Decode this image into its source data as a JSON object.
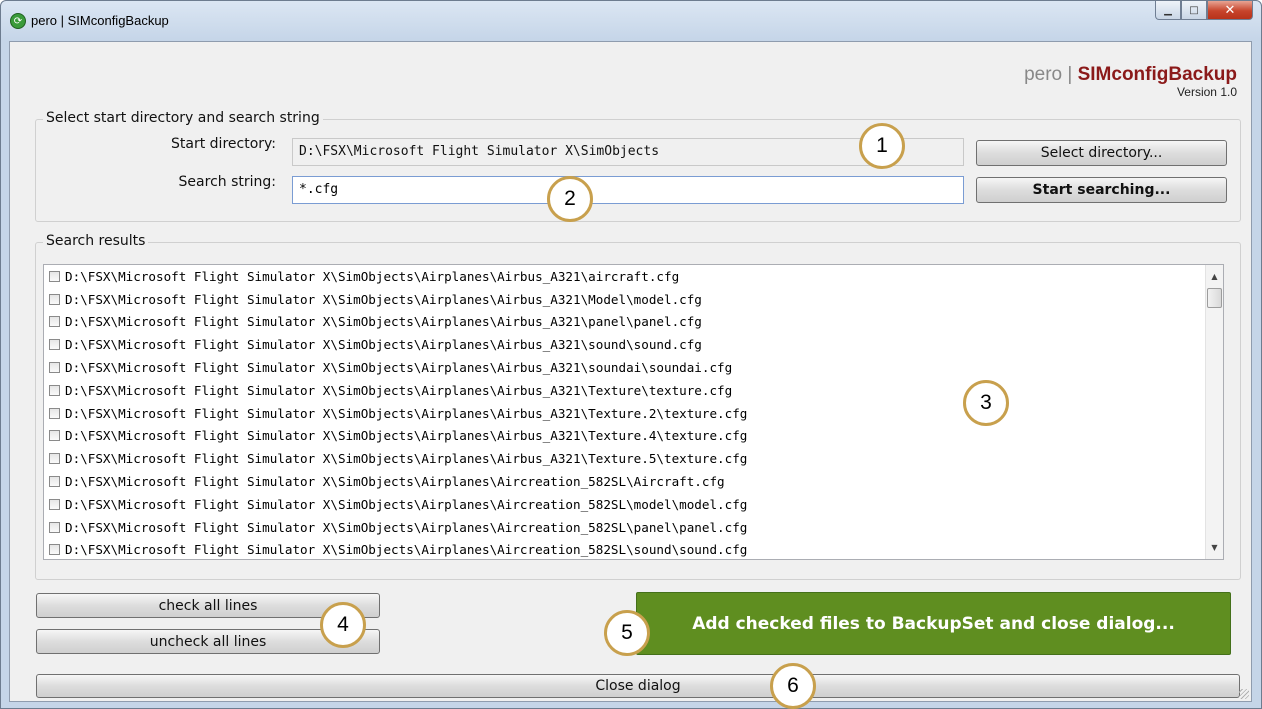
{
  "window": {
    "title": "pero | SIMconfigBackup",
    "icon": "app-logo-icon",
    "controls": {
      "minimize": "minimize-icon",
      "maximize": "maximize-icon",
      "close": "close-icon"
    }
  },
  "brand": {
    "prefix": "pero",
    "separator": "|",
    "name": "SIMconfigBackup",
    "version": "Version 1.0",
    "name_color": "#8b1a1a"
  },
  "search_group": {
    "legend": "Select start directory and search string",
    "start_dir_label": "Start directory:",
    "start_dir_value": "D:\\FSX\\Microsoft Flight Simulator X\\SimObjects",
    "search_label": "Search string:",
    "search_value": "*.cfg",
    "select_dir_button": "Select directory...",
    "start_search_button": "Start searching..."
  },
  "results_group": {
    "legend": "Search results",
    "items": [
      "D:\\FSX\\Microsoft Flight Simulator X\\SimObjects\\Airplanes\\Airbus_A321\\aircraft.cfg",
      "D:\\FSX\\Microsoft Flight Simulator X\\SimObjects\\Airplanes\\Airbus_A321\\Model\\model.cfg",
      "D:\\FSX\\Microsoft Flight Simulator X\\SimObjects\\Airplanes\\Airbus_A321\\panel\\panel.cfg",
      "D:\\FSX\\Microsoft Flight Simulator X\\SimObjects\\Airplanes\\Airbus_A321\\sound\\sound.cfg",
      "D:\\FSX\\Microsoft Flight Simulator X\\SimObjects\\Airplanes\\Airbus_A321\\soundai\\soundai.cfg",
      "D:\\FSX\\Microsoft Flight Simulator X\\SimObjects\\Airplanes\\Airbus_A321\\Texture\\texture.cfg",
      "D:\\FSX\\Microsoft Flight Simulator X\\SimObjects\\Airplanes\\Airbus_A321\\Texture.2\\texture.cfg",
      "D:\\FSX\\Microsoft Flight Simulator X\\SimObjects\\Airplanes\\Airbus_A321\\Texture.4\\texture.cfg",
      "D:\\FSX\\Microsoft Flight Simulator X\\SimObjects\\Airplanes\\Airbus_A321\\Texture.5\\texture.cfg",
      "D:\\FSX\\Microsoft Flight Simulator X\\SimObjects\\Airplanes\\Aircreation_582SL\\Aircraft.cfg",
      "D:\\FSX\\Microsoft Flight Simulator X\\SimObjects\\Airplanes\\Aircreation_582SL\\model\\model.cfg",
      "D:\\FSX\\Microsoft Flight Simulator X\\SimObjects\\Airplanes\\Aircreation_582SL\\panel\\panel.cfg",
      "D:\\FSX\\Microsoft Flight Simulator X\\SimObjects\\Airplanes\\Aircreation_582SL\\sound\\sound.cfg"
    ]
  },
  "actions": {
    "check_all": "check all lines",
    "uncheck_all": "uncheck all lines",
    "add_to_backup": "Add checked files to BackupSet and close dialog...",
    "close_dialog": "Close dialog",
    "accent_color": "#5f8e20"
  },
  "callouts": [
    "1",
    "2",
    "3",
    "4",
    "5",
    "6"
  ]
}
